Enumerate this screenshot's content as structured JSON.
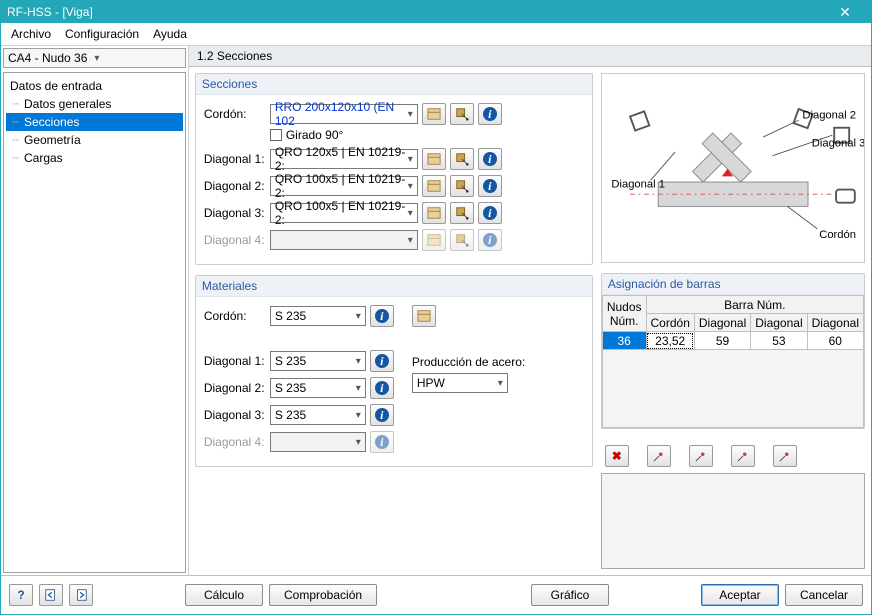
{
  "title": "RF-HSS - [Viga]",
  "menu": {
    "archivo": "Archivo",
    "configuracion": "Configuración",
    "ayuda": "Ayuda"
  },
  "case_selector": "CA4 - Nudo 36",
  "tree": {
    "root": "Datos de entrada",
    "items": [
      "Datos generales",
      "Secciones",
      "Geometría",
      "Cargas"
    ],
    "selected_index": 1
  },
  "panel_title": "1.2 Secciones",
  "secciones": {
    "title": "Secciones",
    "rows": [
      {
        "label": "Cordón:",
        "value": "RRO 200x120x10 (EN 102",
        "chord": true,
        "enabled": true
      },
      {
        "label": "Diagonal 1:",
        "value": "QRO 120x5 | EN 10219-2:",
        "chord": false,
        "enabled": true
      },
      {
        "label": "Diagonal 2:",
        "value": "QRO 100x5 | EN 10219-2:",
        "chord": false,
        "enabled": true
      },
      {
        "label": "Diagonal 3:",
        "value": "QRO 100x5 | EN 10219-2:",
        "chord": false,
        "enabled": true
      },
      {
        "label": "Diagonal 4:",
        "value": "",
        "chord": false,
        "enabled": false
      }
    ],
    "girado": "Girado 90°"
  },
  "materiales": {
    "title": "Materiales",
    "rows": [
      {
        "label": "Cordón:",
        "value": "S 235",
        "enabled": true
      },
      {
        "label": "Diagonal 1:",
        "value": "S 235",
        "enabled": true
      },
      {
        "label": "Diagonal 2:",
        "value": "S 235",
        "enabled": true
      },
      {
        "label": "Diagonal 3:",
        "value": "S 235",
        "enabled": true
      },
      {
        "label": "Diagonal 4:",
        "value": "",
        "enabled": false
      }
    ],
    "prod_label": "Producción de acero:",
    "prod_value": "HPW"
  },
  "preview_labels": {
    "d1": "Diagonal 1",
    "d2": "Diagonal 2",
    "d3": "Diagonal 3",
    "cordon": "Cordón"
  },
  "asign": {
    "title": "Asignación de barras",
    "head_nudos": "Nudos Núm.",
    "head_barra": "Barra Núm.",
    "cols": [
      "Cordón",
      "Diagonal",
      "Diagonal",
      "Diagonal"
    ],
    "row": {
      "nudo": "36",
      "cordon": "23,52",
      "d1": "59",
      "d2": "53",
      "d3": "60"
    }
  },
  "buttons": {
    "calculo": "Cálculo",
    "comprobacion": "Comprobación",
    "grafico": "Gráfico",
    "aceptar": "Aceptar",
    "cancelar": "Cancelar"
  }
}
